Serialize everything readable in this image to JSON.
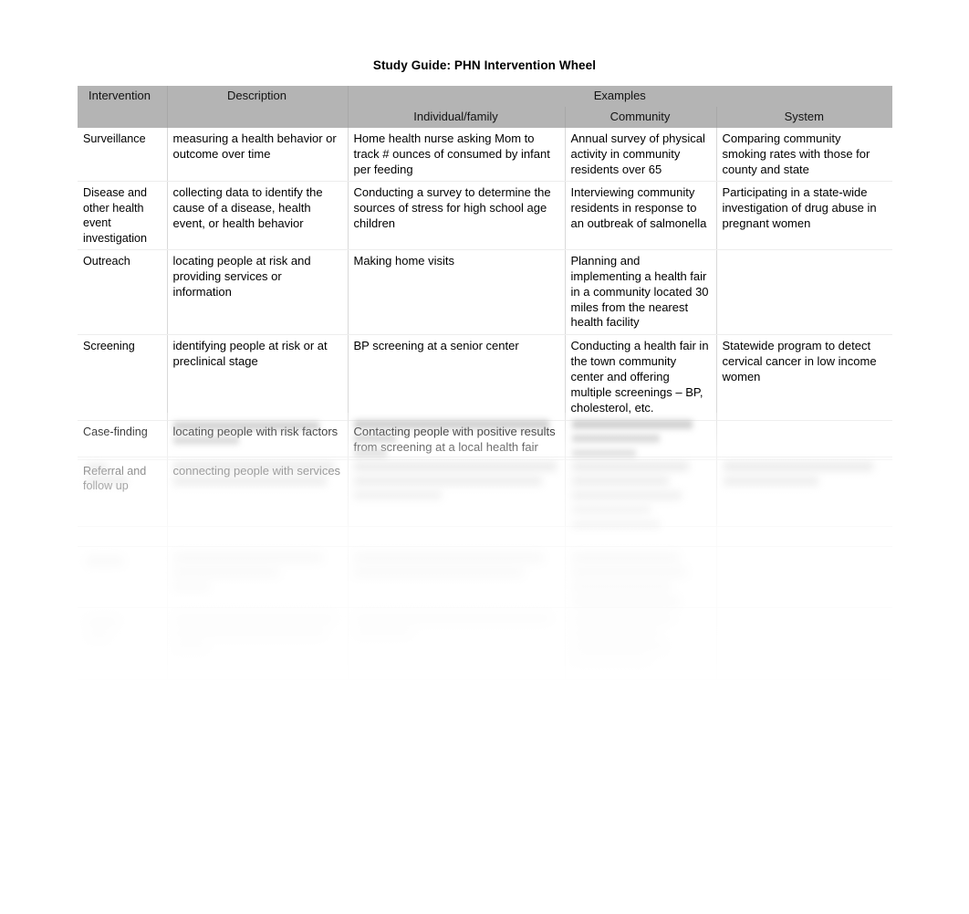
{
  "document": {
    "title": "Study Guide: PHN Intervention Wheel"
  },
  "table": {
    "header_top": {
      "intervention": "Intervention",
      "description": "Description",
      "examples": "Examples"
    },
    "header_sub": {
      "individual_family": "Individual/family",
      "community": "Community",
      "system": "System"
    },
    "columns": [
      "Intervention",
      "Description",
      "Individual/family",
      "Community",
      "System"
    ],
    "rows": [
      {
        "intervention": "Surveillance",
        "description": "measuring a health behavior or outcome over time",
        "individual_family": "Home health nurse asking Mom to track # ounces of consumed by infant per feeding",
        "community": "Annual survey of physical activity in community residents over 65",
        "system": "Comparing community smoking rates with those for county and state",
        "legible": true
      },
      {
        "intervention": "Disease and other health event investigation",
        "description": "collecting data to identify the cause of a disease, health event, or health behavior",
        "individual_family": "Conducting a survey to determine the sources of stress for high school age children",
        "community": "Interviewing community residents in response to an outbreak of salmonella",
        "system": "Participating in a state-wide investigation of drug abuse in pregnant women",
        "legible": true
      },
      {
        "intervention": "Outreach",
        "description": "locating people at risk and providing services or information",
        "individual_family": "Making home visits",
        "community": "Planning and implementing a health fair in a community located 30 miles from the nearest health facility",
        "system": "",
        "legible": true
      },
      {
        "intervention": "Screening",
        "description": "identifying people at risk or at preclinical stage",
        "individual_family": "BP screening at a senior center",
        "community": "Conducting a health fair in the town community center and offering multiple screenings – BP, cholesterol, etc.",
        "system": "Statewide program to detect cervical cancer in low income women",
        "legible": true
      },
      {
        "intervention": "Case-finding",
        "description": "locating people with risk factors",
        "individual_family": "Contacting people with positive results from screening at a local health fair",
        "community": "",
        "system": "",
        "legible": true
      },
      {
        "intervention": "Referral and follow up",
        "description": "connecting people with services",
        "individual_family": "",
        "community": "",
        "system": "",
        "legible": true
      }
    ],
    "obscured_note": "Remaining table rows are blurred in the source image and their text is not legible."
  }
}
